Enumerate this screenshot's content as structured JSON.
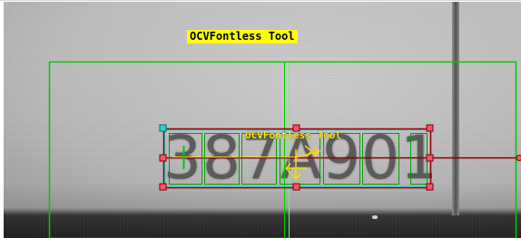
{
  "tool": {
    "title_label": "OCVFontless Tool",
    "roi_label": "OCVFontless Tool"
  },
  "inspection": {
    "read_string": "387A901"
  },
  "colors": {
    "search_region": "#00c800",
    "roi_box": "#8b0000",
    "roi_inner": "#00e5ff",
    "character_box": "#00a000",
    "handle": "#ff4f6d",
    "label_highlight": "#ffff00",
    "origin_marker": "#ffd700"
  },
  "icons": {
    "roi_handle": "square-handle-icon",
    "origin_marker": "origin-crosshair-icon",
    "rotate_handle": "rotate-handle-icon"
  }
}
